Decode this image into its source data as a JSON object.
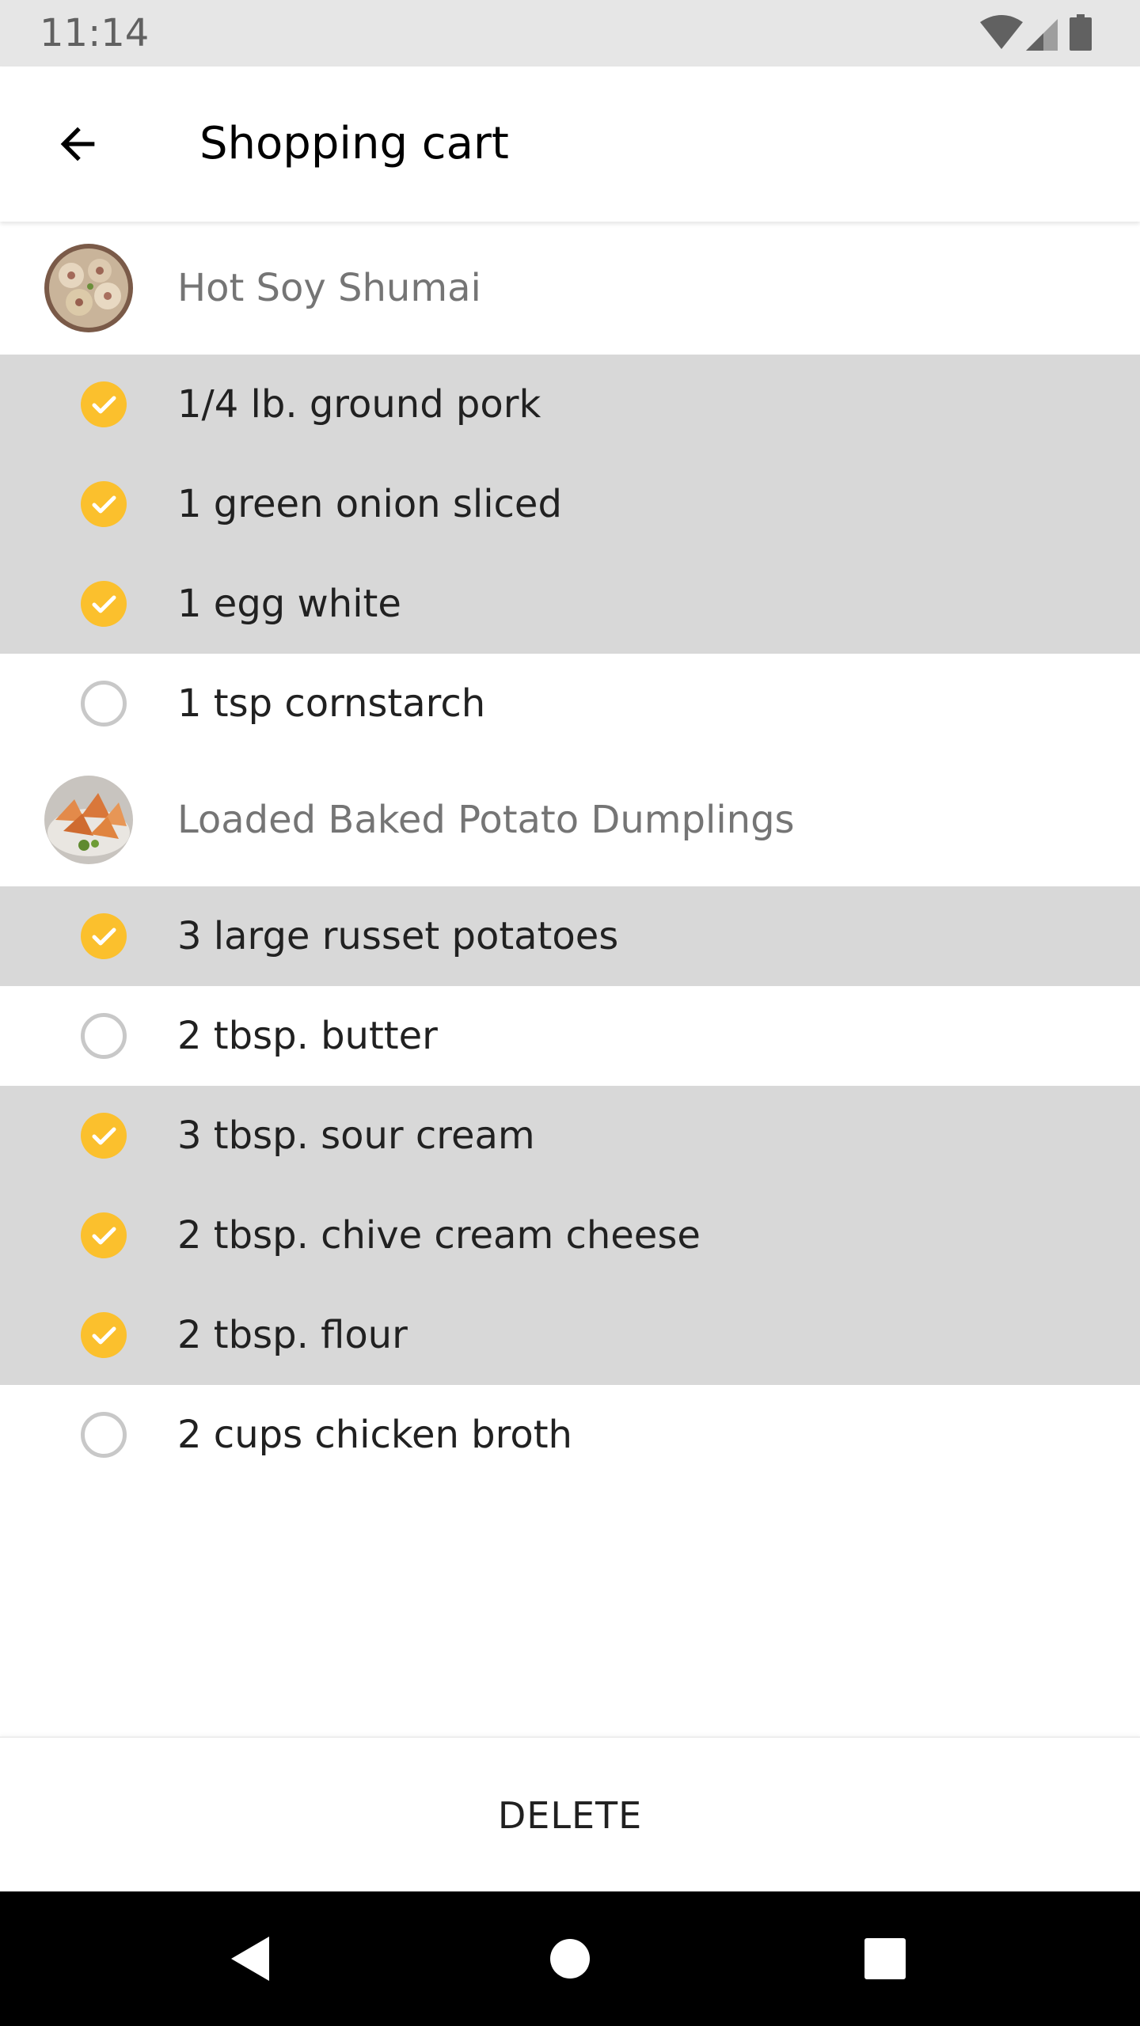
{
  "status_bar": {
    "time": "11:14",
    "icons": [
      "wifi-icon",
      "cellular-signal-icon",
      "battery-icon"
    ]
  },
  "app_bar": {
    "title": "Shopping cart",
    "back_icon": "arrow-back-icon"
  },
  "colors": {
    "accent": "#fbc02d",
    "checked_row_bg": "#d8d8d8",
    "recipe_name": "#757575"
  },
  "recipes": [
    {
      "name": "Hot Soy Shumai",
      "ingredients": [
        {
          "label": "1/4 lb. ground pork",
          "checked": true
        },
        {
          "label": "1 green onion sliced",
          "checked": true
        },
        {
          "label": "1 egg white",
          "checked": true
        },
        {
          "label": "1 tsp cornstarch",
          "checked": false
        }
      ]
    },
    {
      "name": "Loaded Baked Potato Dumplings",
      "ingredients": [
        {
          "label": "3 large russet potatoes",
          "checked": true
        },
        {
          "label": "2 tbsp. butter",
          "checked": false
        },
        {
          "label": "3 tbsp. sour cream",
          "checked": true
        },
        {
          "label": "2 tbsp. chive cream cheese",
          "checked": true
        },
        {
          "label": "2 tbsp. flour",
          "checked": true
        },
        {
          "label": "2 cups chicken broth",
          "checked": false
        }
      ]
    }
  ],
  "footer": {
    "delete_label": "DELETE"
  },
  "nav_bar": {
    "icons": [
      "back-triangle-icon",
      "home-circle-icon",
      "recents-square-icon"
    ]
  }
}
